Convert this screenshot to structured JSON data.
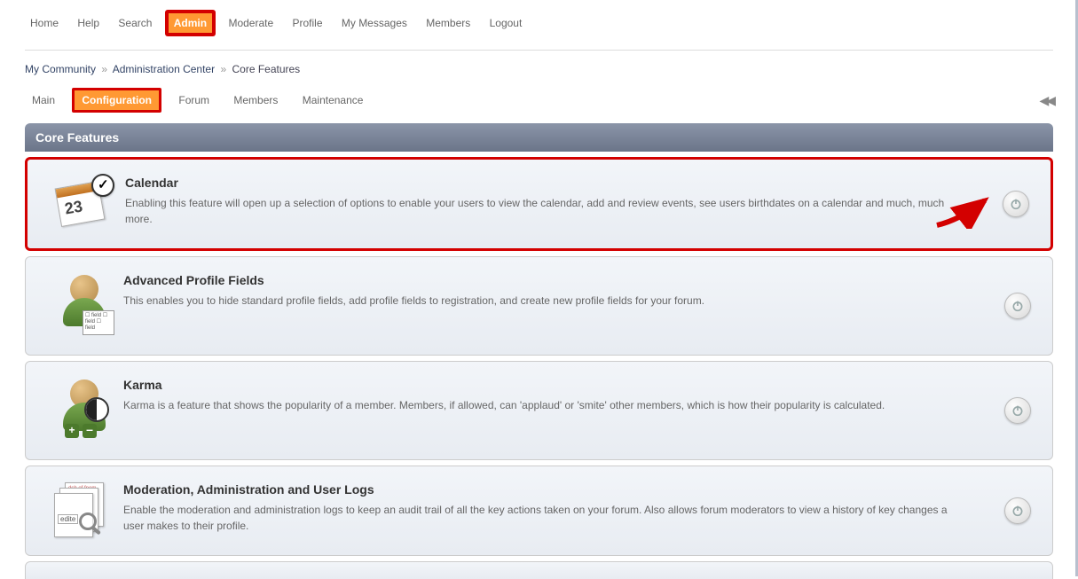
{
  "topnav": {
    "items": [
      "Home",
      "Help",
      "Search",
      "Admin",
      "Moderate",
      "Profile",
      "My Messages",
      "Members",
      "Logout"
    ],
    "active_index": 3
  },
  "breadcrumb": {
    "items": [
      "My Community",
      "Administration Center",
      "Core Features"
    ],
    "sep": "»"
  },
  "subnav": {
    "items": [
      "Main",
      "Configuration",
      "Forum",
      "Members",
      "Maintenance"
    ],
    "active_index": 1
  },
  "panel": {
    "title": "Core Features"
  },
  "features": [
    {
      "title": "Calendar",
      "desc": "Enabling this feature will open up a selection of options to enable your users to view the calendar, add and review events, see users birthdates on a calendar and much, much more.",
      "highlighted": true,
      "show_arrow": true,
      "icon": "calendar",
      "cal_num": "23"
    },
    {
      "title": "Advanced Profile Fields",
      "desc": "This enables you to hide standard profile fields, add profile fields to registration, and create new profile fields for your forum.",
      "icon": "profile-fields",
      "field_labels": "☐ field\n☐ field\n☐ field"
    },
    {
      "title": "Karma",
      "desc": "Karma is a feature that shows the popularity of a member. Members, if allowed, can 'applaud' or 'smite' other members, which is how their popularity is calculated.",
      "icon": "karma"
    },
    {
      "title": "Moderation, Administration and User Logs",
      "desc": "Enable the moderation and administration logs to keep an audit trail of all the key actions taken on your forum. Also allows forum moderators to view a history of key changes a user makes to their profile.",
      "icon": "logs",
      "edit_label": "edite"
    }
  ]
}
